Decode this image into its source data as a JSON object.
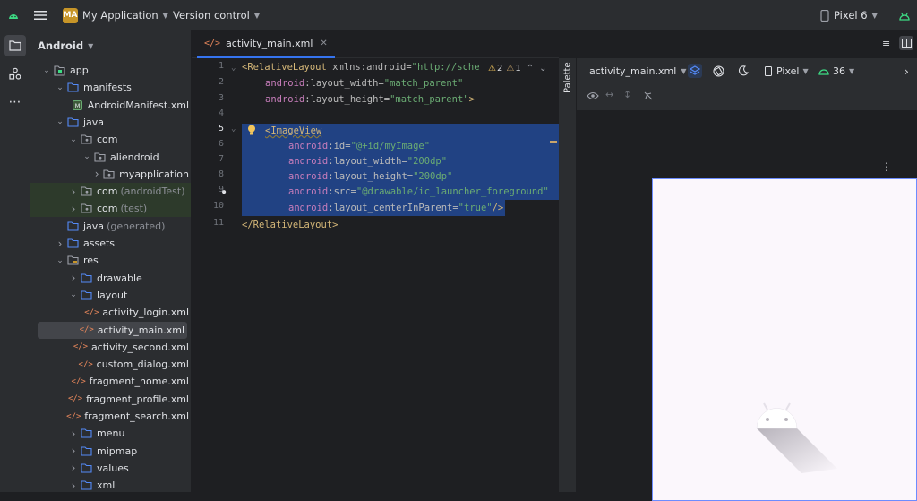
{
  "topbar": {
    "project_badge": "MA",
    "project_name": "My Application",
    "vcs": "Version control",
    "device": "Pixel 6"
  },
  "project_panel": {
    "view_mode": "Android",
    "tree": [
      {
        "label": "app",
        "suffix": ""
      },
      {
        "label": "manifests",
        "suffix": ""
      },
      {
        "label": "AndroidManifest.xml",
        "suffix": ""
      },
      {
        "label": "java",
        "suffix": ""
      },
      {
        "label": "com",
        "suffix": ""
      },
      {
        "label": "aliendroid",
        "suffix": ""
      },
      {
        "label": "myapplication",
        "suffix": ""
      },
      {
        "label": "com",
        "suffix": "(androidTest)"
      },
      {
        "label": "com",
        "suffix": "(test)"
      },
      {
        "label": "java",
        "suffix": "(generated)"
      },
      {
        "label": "assets",
        "suffix": ""
      },
      {
        "label": "res",
        "suffix": ""
      },
      {
        "label": "drawable",
        "suffix": ""
      },
      {
        "label": "layout",
        "suffix": ""
      },
      {
        "label": "activity_login.xml",
        "suffix": ""
      },
      {
        "label": "activity_main.xml",
        "suffix": ""
      },
      {
        "label": "activity_second.xml",
        "suffix": ""
      },
      {
        "label": "custom_dialog.xml",
        "suffix": ""
      },
      {
        "label": "fragment_home.xml",
        "suffix": ""
      },
      {
        "label": "fragment_profile.xml",
        "suffix": ""
      },
      {
        "label": "fragment_search.xml",
        "suffix": ""
      },
      {
        "label": "menu",
        "suffix": ""
      },
      {
        "label": "mipmap",
        "suffix": ""
      },
      {
        "label": "values",
        "suffix": ""
      },
      {
        "label": "xml",
        "suffix": ""
      }
    ]
  },
  "editor": {
    "tab_label": "activity_main.xml",
    "line_numbers": [
      "1",
      "2",
      "3",
      "4",
      "5",
      "6",
      "7",
      "8",
      "9",
      "10",
      "11"
    ],
    "warning_count": "2",
    "weak_warning_count": "1",
    "lines": {
      "l1_tag": "<RelativeLayout",
      "l1_attr": " xmlns:android=",
      "l1_val": "\"http://sche",
      "l2_ns": "android",
      "l2_attr": ":layout_width=",
      "l2_val": "\"match_parent\"",
      "l3_ns": "android",
      "l3_attr": ":layout_height=",
      "l3_val": "\"match_parent\"",
      "l3_end": ">",
      "l5_tag": "<ImageView",
      "l6_ns": "android",
      "l6_attr": ":id=",
      "l6_val": "\"@+id/myImage\"",
      "l7_ns": "android",
      "l7_attr": ":layout_width=",
      "l7_val": "\"200dp\"",
      "l8_ns": "android",
      "l8_attr": ":layout_height=",
      "l8_val": "\"200dp\"",
      "l9_ns": "android",
      "l9_attr": ":src=",
      "l9_val": "\"@drawable/ic_launcher_foreground\"",
      "l10_ns": "android",
      "l10_attr": ":layout_centerInParent=",
      "l10_val": "\"true\"",
      "l10_end": "/>",
      "l11_tag": "</RelativeLayout>"
    }
  },
  "design": {
    "palette_label": "Palette",
    "file": "activity_main.xml",
    "device": "Pixel",
    "api": "36"
  },
  "colors": {
    "accent": "#3574f0",
    "selection": "#214283",
    "android_green": "#3ddc84",
    "badge": "#c79528"
  }
}
